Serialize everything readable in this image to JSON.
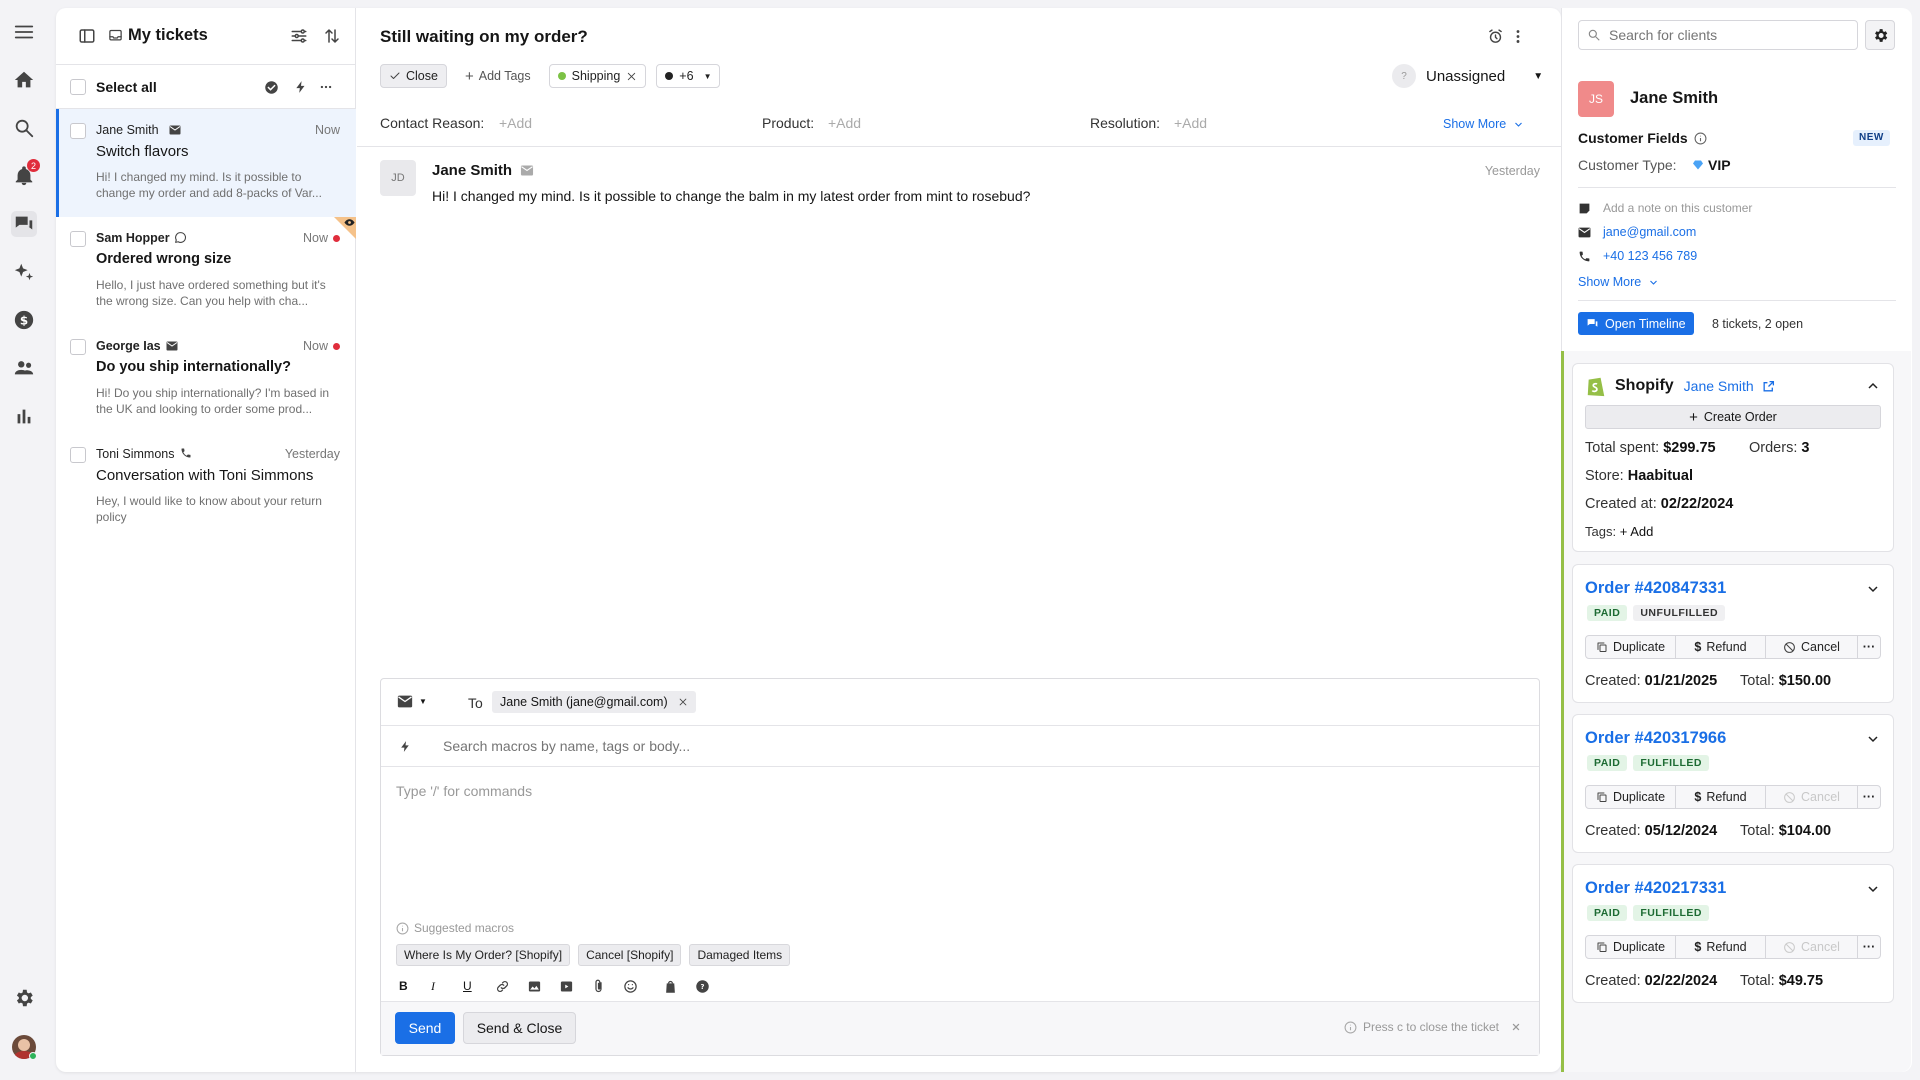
{
  "rail": {
    "notifications_count": "2"
  },
  "list": {
    "title": "My tickets",
    "select_all": "Select all",
    "tickets": [
      {
        "name": "Jane Smith",
        "time": "Now",
        "subject": "Switch flavors",
        "preview": "Hi! I changed my mind. Is it possible to change my order and add 8-packs of Var...",
        "channel": "email",
        "unread": false
      },
      {
        "name": "Sam Hopper",
        "time": "Now",
        "subject": "Ordered wrong size",
        "preview": "Hello, I just have ordered something but it's the wrong size. Can you help with cha...",
        "channel": "whatsapp",
        "unread": true
      },
      {
        "name": "George Ias",
        "time": "Now",
        "subject": "Do you ship internationally?",
        "preview": "Hi! Do you ship internationally? I'm based in the UK and looking to order some prod...",
        "channel": "email",
        "unread": true
      },
      {
        "name": "Toni Simmons",
        "time": "Yesterday",
        "subject": "Conversation with Toni Simmons",
        "preview": "Hey, I would like to know about your return policy",
        "channel": "phone",
        "unread": false
      }
    ]
  },
  "ticket": {
    "title": "Still waiting on my order?",
    "close_label": "Close",
    "add_tags_label": "Add Tags",
    "tag_shipping": "Shipping",
    "tag_more": "+6",
    "assignee_avatar": "?",
    "assignee": "Unassigned",
    "contact_reason_label": "Contact Reason:",
    "product_label": "Product:",
    "resolution_label": "Resolution:",
    "add_placeholder": "+Add",
    "show_more": "Show More"
  },
  "message": {
    "avatar": "JD",
    "author": "Jane Smith",
    "time": "Yesterday",
    "body": "Hi! I changed my mind. Is it possible to change the balm in my latest order from mint to rosebud?"
  },
  "composer": {
    "to_label": "To",
    "recipient": "Jane Smith (jane@gmail.com)",
    "macro_search_placeholder": "Search macros by name, tags or body...",
    "body_placeholder": "Type '/' for commands",
    "suggested_label": "Suggested macros",
    "macros": [
      "Where Is My Order? [Shopify]",
      "Cancel [Shopify]",
      "Damaged Items"
    ],
    "send_label": "Send",
    "send_close_label": "Send & Close",
    "hint": "Press c to close the ticket"
  },
  "customer": {
    "search_placeholder": "Search for clients",
    "initials": "JS",
    "name": "Jane Smith",
    "fields_title": "Customer Fields",
    "new_badge": "NEW",
    "type_label": "Customer Type:",
    "type_value": "VIP",
    "note_placeholder": "Add a note on this customer",
    "email": "jane@gmail.com",
    "phone": "+40 123 456 789",
    "show_more": "Show More",
    "timeline_button": "Open Timeline",
    "tickets_summary": "8 tickets, 2 open"
  },
  "shopify": {
    "title": "Shopify",
    "customer_link": "Jane Smith",
    "create_order": "Create Order",
    "total_spent_label": "Total spent:",
    "total_spent": "$299.75",
    "orders_label": "Orders:",
    "orders": "3",
    "store_label": "Store:",
    "store": "Haabitual",
    "created_label": "Created at:",
    "created": "02/22/2024",
    "tags_label": "Tags:",
    "tags_add": "+ Add"
  },
  "orders": [
    {
      "number": "Order #420847331",
      "status_paid": "PAID",
      "status_fulfillment": "UNFULFILLED",
      "created_label": "Created:",
      "created": "01/21/2025",
      "total_label": "Total:",
      "total": "$150.00",
      "cancel_enabled": true
    },
    {
      "number": "Order #420317966",
      "status_paid": "PAID",
      "status_fulfillment": "FULFILLED",
      "created_label": "Created:",
      "created": "05/12/2024",
      "total_label": "Total:",
      "total": "$104.00",
      "cancel_enabled": false
    },
    {
      "number": "Order #420217331",
      "status_paid": "PAID",
      "status_fulfillment": "FULFILLED",
      "created_label": "Created:",
      "created": "02/22/2024",
      "total_label": "Total:",
      "total": "$49.75",
      "cancel_enabled": false
    }
  ],
  "order_actions": {
    "duplicate": "Duplicate",
    "refund": "Refund",
    "cancel": "Cancel"
  },
  "colors": {
    "accent": "#1a6fe6",
    "unread": "#e02d3c",
    "selected_bg": "#eef4fd",
    "shopify_green": "#95bf47",
    "avatar": "#f08a8a"
  }
}
